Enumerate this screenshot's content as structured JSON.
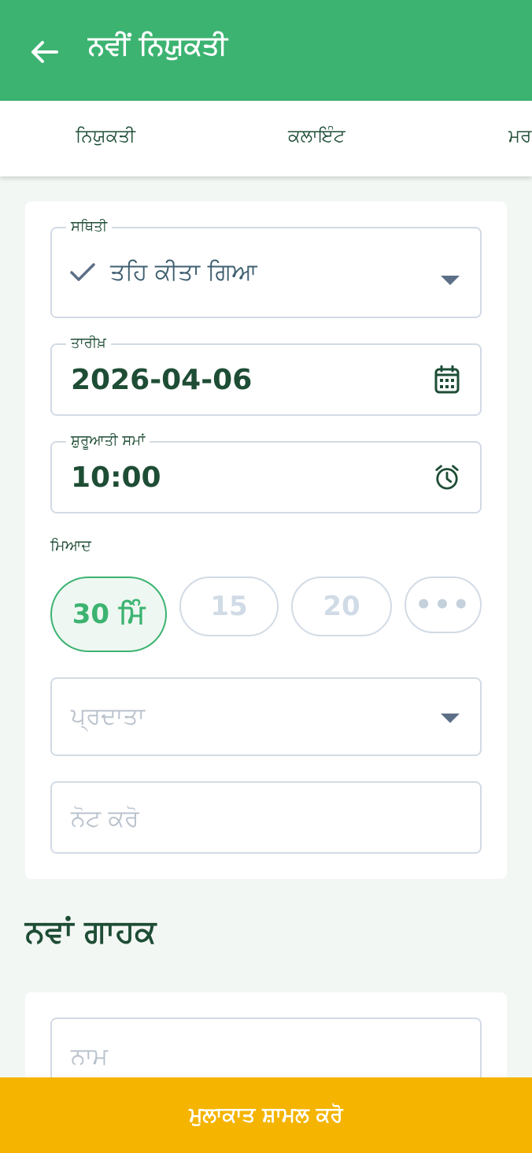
{
  "appbar": {
    "title": "ਨਵੀਂ ਨਿਯੁਕਤੀ",
    "back_icon": "arrow-left-icon"
  },
  "tabs": [
    {
      "label": "ਨਿਯੁਕਤੀ"
    },
    {
      "label": "ਕਲਾਇੰਟ"
    },
    {
      "label": "ਮਰ"
    }
  ],
  "form": {
    "status": {
      "label": "ਸਥਿਤੀ",
      "value": "ਤਹਿ ਕੀਤਾ ਗਿਆ",
      "icon": "check-icon"
    },
    "date": {
      "label": "ਤਾਰੀਖ਼",
      "value": "2026-04-06",
      "icon": "calendar-icon"
    },
    "start_time": {
      "label": "ਸ਼ੁਰੂਆਤੀ ਸਮਾਂ",
      "value": "10:00",
      "icon": "alarm-clock-icon"
    },
    "duration": {
      "label": "ਮਿਆਦ",
      "options": [
        {
          "label": "30 ਮਿੰ",
          "selected": true
        },
        {
          "label": "15",
          "selected": false
        },
        {
          "label": "20",
          "selected": false
        },
        {
          "label": "•••",
          "selected": false
        }
      ]
    },
    "provider": {
      "placeholder": "ਪ੍ਰਦਾਤਾ"
    },
    "note": {
      "placeholder": "ਨੋਟ ਕਰੋ"
    }
  },
  "new_client": {
    "title": "ਨਵਾਂ ਗਾਹਕ",
    "name": {
      "placeholder": "ਨਾਮ"
    }
  },
  "bottom_button": {
    "label": "ਮੁਲਾਕਾਤ ਸ਼ਾਮਲ ਕਰੋ"
  },
  "colors": {
    "primary": "#3cb371",
    "accent": "#f4b400",
    "text": "#1e4d35",
    "border": "#d2dbe5"
  }
}
